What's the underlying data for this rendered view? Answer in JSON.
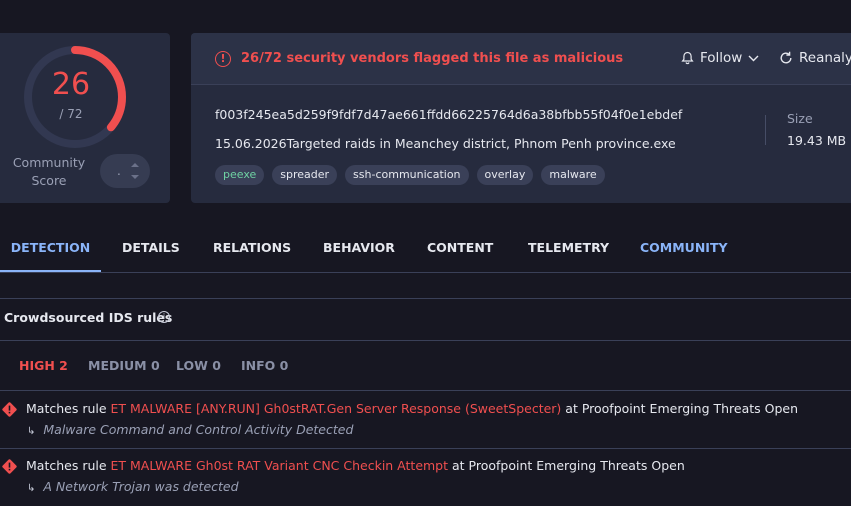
{
  "score": {
    "detections": "26",
    "total": "/ 72",
    "detection_fraction": 0.361,
    "community_label": "Community Score",
    "community_value": "."
  },
  "header": {
    "alert_text": "26/72 security vendors flagged this file as malicious",
    "follow_label": "Follow",
    "reanalyze_label": "Reanalyz"
  },
  "file": {
    "hash": "f003f245ea5d259f9fdf7d47ae661ffdd66225764d6a38bfbb55f04f0e1ebdef",
    "name": "15.06.2026Targeted raids in Meanchey district, Phnom Penh province.exe",
    "size_label": "Size",
    "size_value": "19.43 MB",
    "tags": [
      "peexe",
      "spreader",
      "ssh-communication",
      "overlay",
      "malware"
    ]
  },
  "tabs": [
    "DETECTION",
    "DETAILS",
    "RELATIONS",
    "BEHAVIOR",
    "CONTENT",
    "TELEMETRY",
    "COMMUNITY"
  ],
  "ids": {
    "title": "Crowdsourced IDS rules",
    "filters": [
      "HIGH 2",
      "MEDIUM 0",
      "LOW 0",
      "INFO 0"
    ],
    "rules": [
      {
        "prefix": "Matches rule ",
        "name": "ET MALWARE [ANY.RUN] Gh0stRAT.Gen Server Response (SweetSpecter)",
        "suffix": " at Proofpoint Emerging Threats Open",
        "description": "Malware Command and Control Activity Detected"
      },
      {
        "prefix": "Matches rule ",
        "name": "ET MALWARE Gh0st RAT Variant CNC Checkin Attempt",
        "suffix": " at Proofpoint Emerging Threats Open",
        "description": "A Network Trojan was detected"
      }
    ]
  },
  "colors": {
    "danger": "#f04f4f",
    "accent": "#8ab4f8",
    "card": "#262b3e",
    "background": "#171722"
  }
}
